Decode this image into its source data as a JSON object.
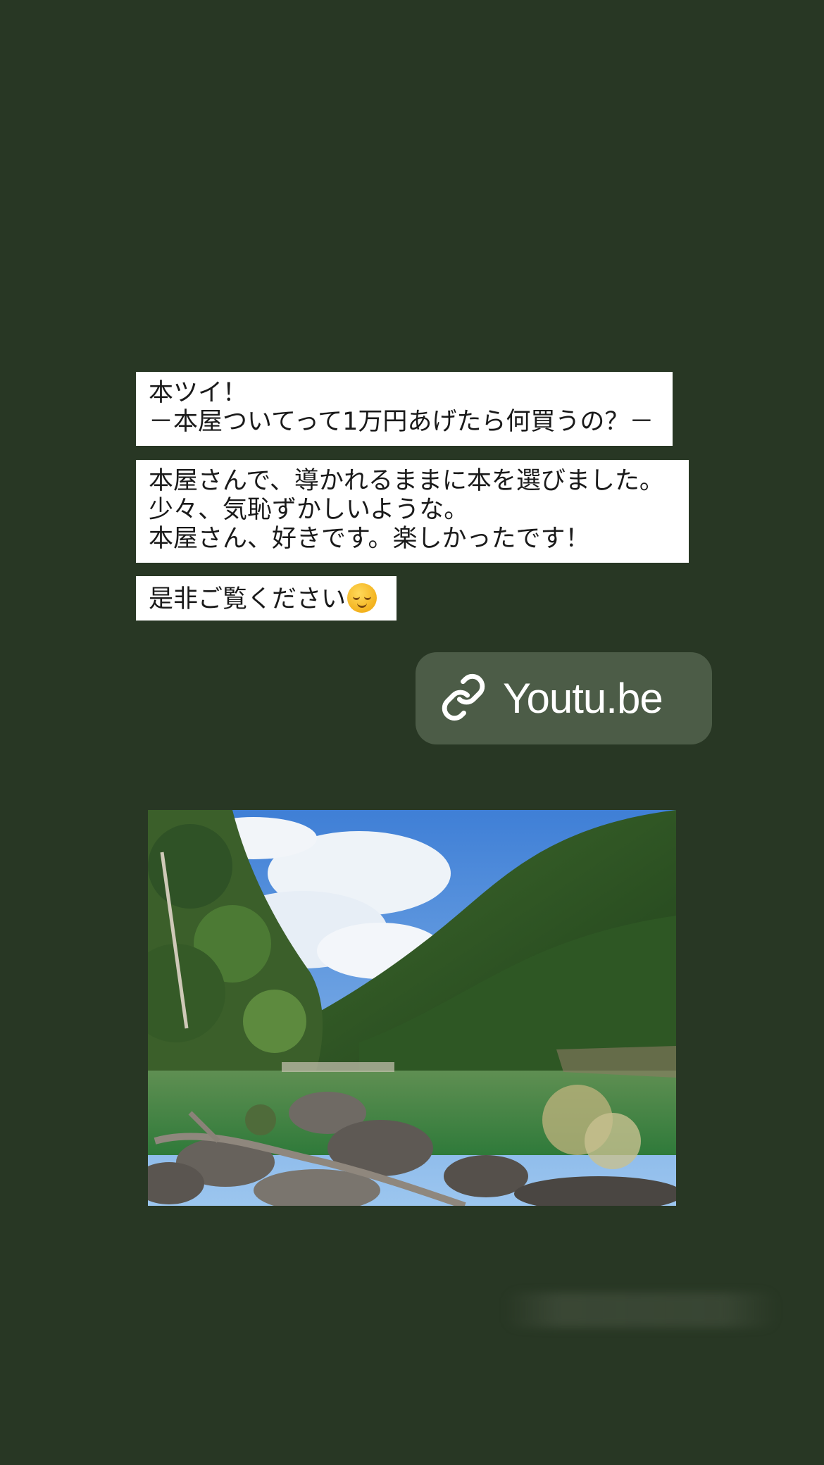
{
  "captions": {
    "first": "本ツイ！\n－本屋ついてって1万円あげたら何買うの？－",
    "second": "本屋さんで、導かれるままに本を選びました。\n少々、気恥ずかしいような。\n本屋さん、好きです。楽しかったです！",
    "third": "是非ご覧ください"
  },
  "link_sticker": {
    "label": "Youtu.be",
    "icon": "link-icon"
  },
  "photo": {
    "icon": "landscape-photo"
  },
  "colors": {
    "background": "#283724",
    "sticker_bg": "#4c5c47",
    "caption_bg": "#ffffff"
  }
}
